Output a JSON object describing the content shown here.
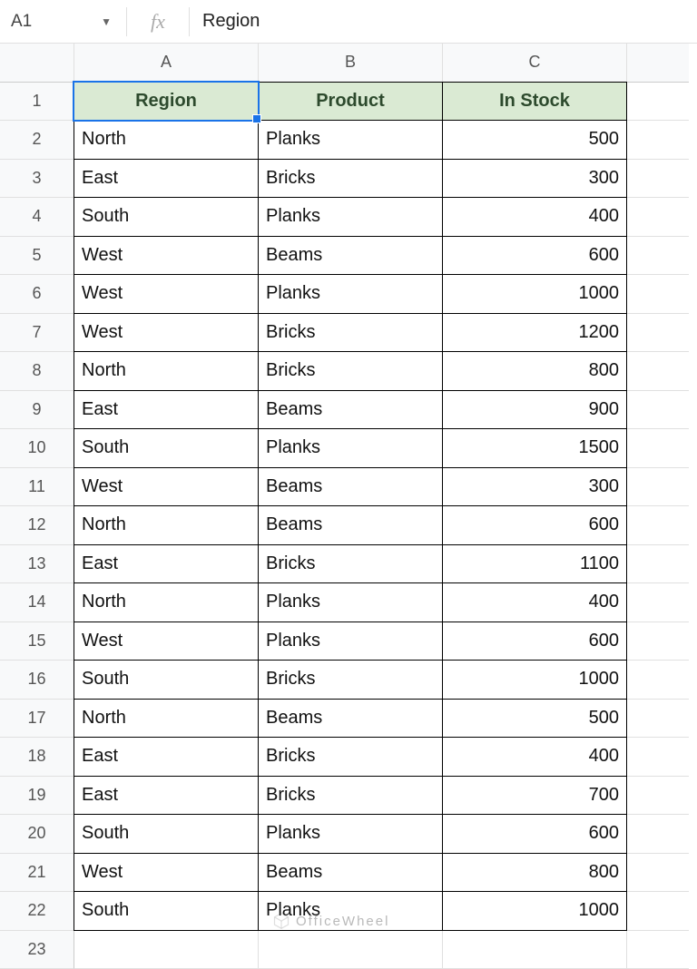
{
  "nameBox": "A1",
  "fxLabel": "fx",
  "formulaValue": "Region",
  "columns": [
    "A",
    "B",
    "C"
  ],
  "headerRow": [
    "Region",
    "Product",
    "In Stock"
  ],
  "rows": [
    {
      "n": 2,
      "region": "North",
      "product": "Planks",
      "stock": "500"
    },
    {
      "n": 3,
      "region": "East",
      "product": "Bricks",
      "stock": "300"
    },
    {
      "n": 4,
      "region": "South",
      "product": "Planks",
      "stock": "400"
    },
    {
      "n": 5,
      "region": "West",
      "product": "Beams",
      "stock": "600"
    },
    {
      "n": 6,
      "region": "West",
      "product": "Planks",
      "stock": "1000"
    },
    {
      "n": 7,
      "region": "West",
      "product": "Bricks",
      "stock": "1200"
    },
    {
      "n": 8,
      "region": "North",
      "product": "Bricks",
      "stock": "800"
    },
    {
      "n": 9,
      "region": "East",
      "product": "Beams",
      "stock": "900"
    },
    {
      "n": 10,
      "region": "South",
      "product": "Planks",
      "stock": "1500"
    },
    {
      "n": 11,
      "region": "West",
      "product": "Beams",
      "stock": "300"
    },
    {
      "n": 12,
      "region": "North",
      "product": "Beams",
      "stock": "600"
    },
    {
      "n": 13,
      "region": "East",
      "product": "Bricks",
      "stock": "1100"
    },
    {
      "n": 14,
      "region": "North",
      "product": "Planks",
      "stock": "400"
    },
    {
      "n": 15,
      "region": "West",
      "product": "Planks",
      "stock": "600"
    },
    {
      "n": 16,
      "region": "South",
      "product": "Bricks",
      "stock": "1000"
    },
    {
      "n": 17,
      "region": "North",
      "product": "Beams",
      "stock": "500"
    },
    {
      "n": 18,
      "region": "East",
      "product": "Bricks",
      "stock": "400"
    },
    {
      "n": 19,
      "region": "East",
      "product": "Bricks",
      "stock": "700"
    },
    {
      "n": 20,
      "region": "South",
      "product": "Planks",
      "stock": "600"
    },
    {
      "n": 21,
      "region": "West",
      "product": "Beams",
      "stock": "800"
    },
    {
      "n": 22,
      "region": "South",
      "product": "Planks",
      "stock": "1000"
    }
  ],
  "emptyRow": 23,
  "watermark": "OfficeWheel"
}
